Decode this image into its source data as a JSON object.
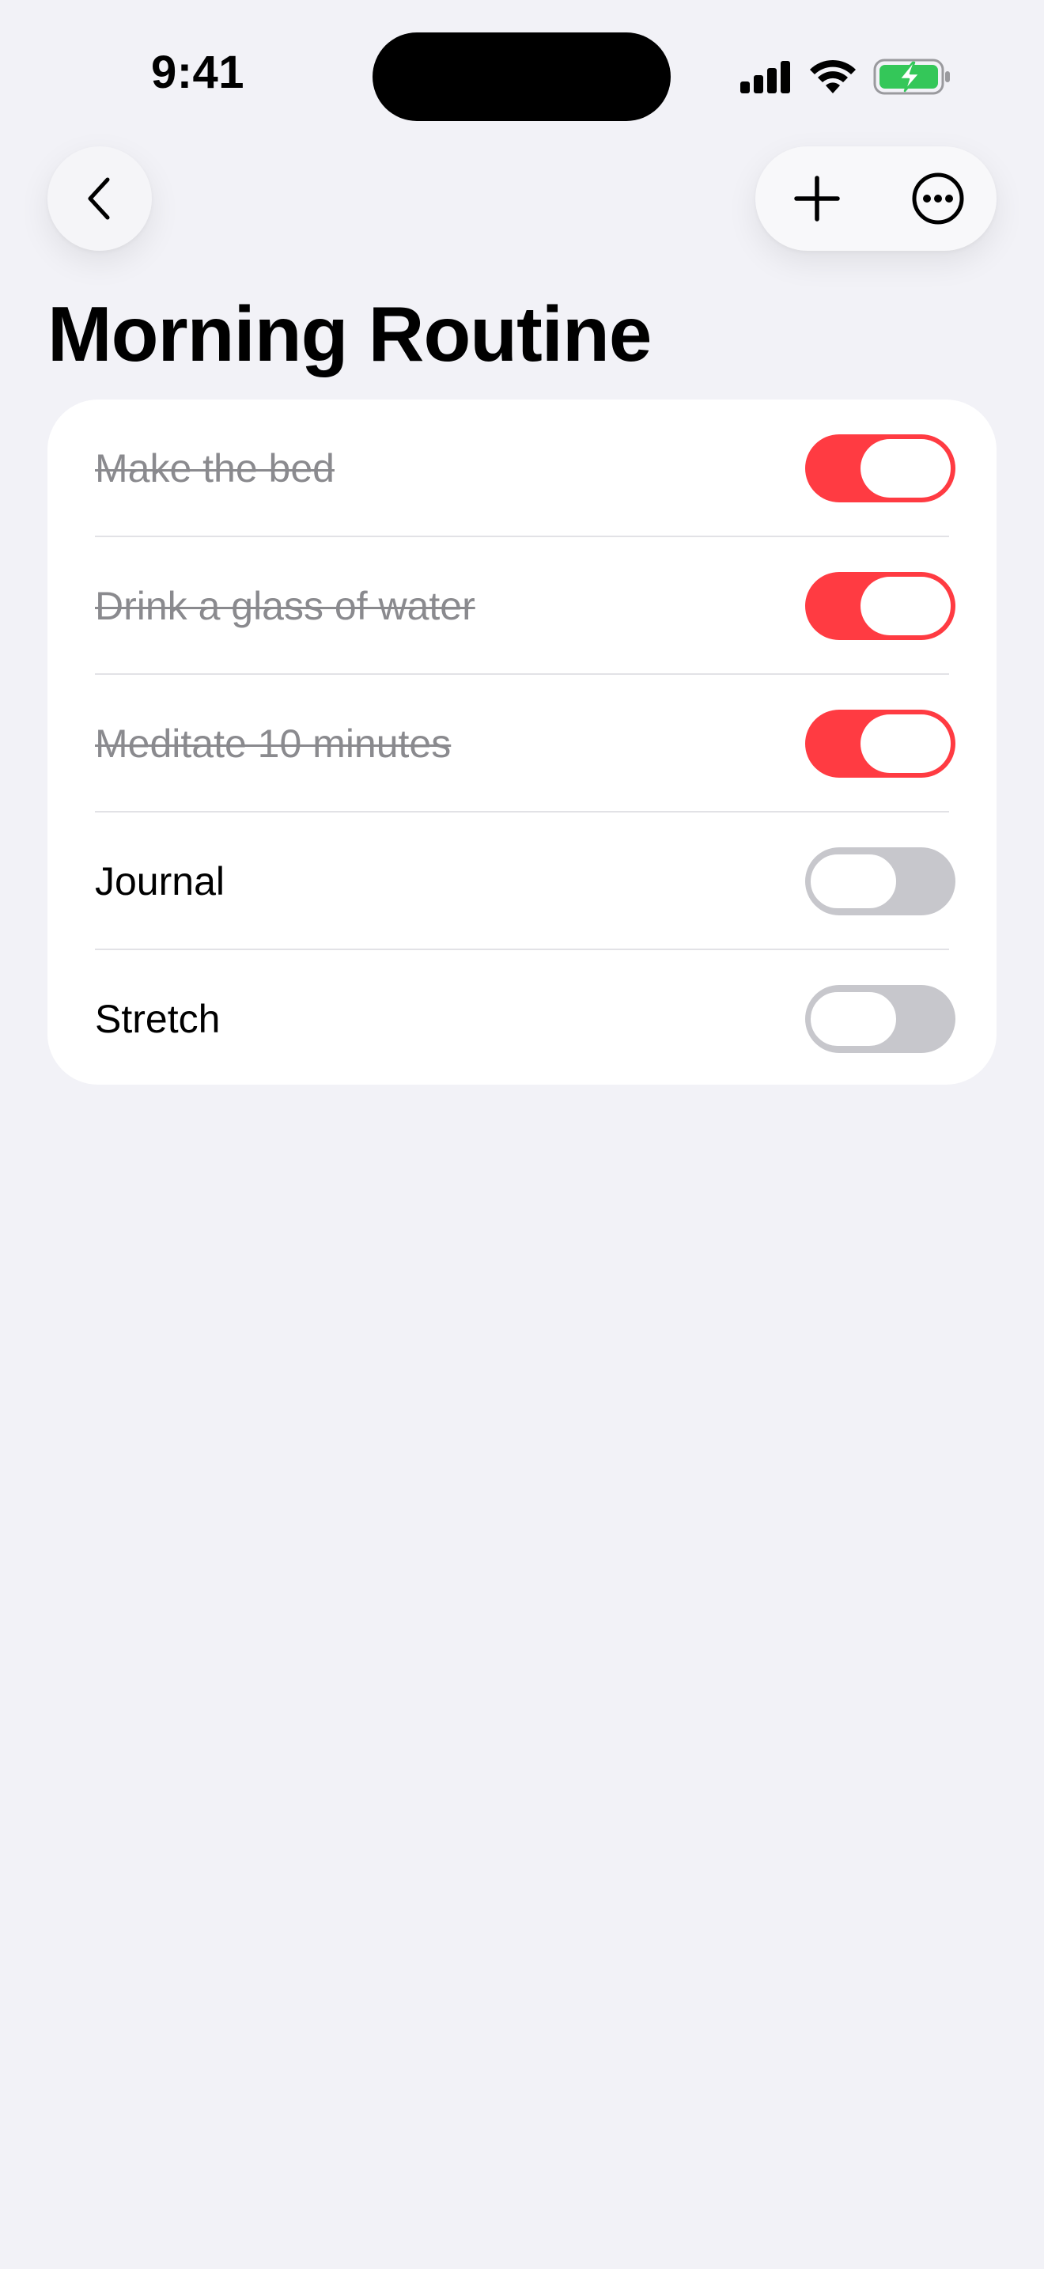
{
  "status_bar": {
    "time": "9:41",
    "battery_color": "#34C759"
  },
  "nav": {
    "back_icon": "chevron-left-icon",
    "add_icon": "plus-icon",
    "more_icon": "ellipsis-circle-icon"
  },
  "title": "Morning Routine",
  "accent_color": "#FF3B42",
  "tasks": [
    {
      "label": "Make the bed",
      "completed": true
    },
    {
      "label": "Drink a glass of water",
      "completed": true
    },
    {
      "label": "Meditate 10 minutes",
      "completed": true
    },
    {
      "label": "Journal",
      "completed": false
    },
    {
      "label": "Stretch",
      "completed": false
    }
  ]
}
